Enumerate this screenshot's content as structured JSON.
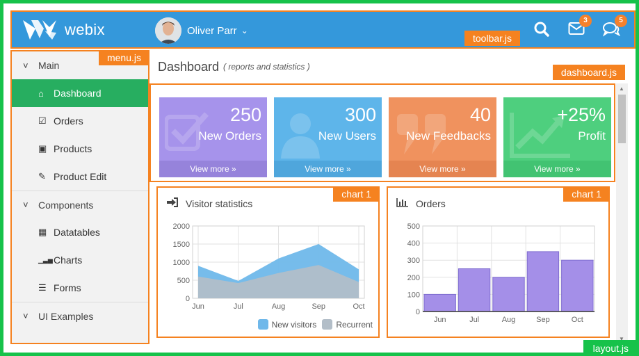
{
  "toolbar": {
    "logo_text": "webix",
    "user_name": "Oliver Parr",
    "mail_badge": "3",
    "chat_badge": "5",
    "tag": "toolbar.js"
  },
  "sidebar": {
    "tag": "menu.js",
    "items": [
      {
        "label": "Main",
        "kind": "group",
        "icon": "chevron-down-icon"
      },
      {
        "label": "Dashboard",
        "kind": "child",
        "icon": "home-icon",
        "active": true
      },
      {
        "label": "Orders",
        "kind": "child",
        "icon": "check-square-icon"
      },
      {
        "label": "Products",
        "kind": "child",
        "icon": "cube-icon"
      },
      {
        "label": "Product Edit",
        "kind": "child",
        "icon": "edit-icon"
      },
      {
        "label": "Components",
        "kind": "group",
        "icon": "chevron-down-icon"
      },
      {
        "label": "Datatables",
        "kind": "child",
        "icon": "table-icon"
      },
      {
        "label": "Charts",
        "kind": "child",
        "icon": "bar-chart-icon"
      },
      {
        "label": "Forms",
        "kind": "child",
        "icon": "form-icon"
      },
      {
        "label": "UI Examples",
        "kind": "group",
        "icon": "chevron-down-icon"
      }
    ]
  },
  "header": {
    "title": "Dashboard",
    "subtitle": "( reports and statistics )",
    "tag": "dashboard.js"
  },
  "tiles": [
    {
      "value": "250",
      "label": "New Orders",
      "more": "View more  »",
      "color": "#a693eb",
      "footer": "#9683db"
    },
    {
      "value": "300",
      "label": "New Users",
      "more": "View more  »",
      "color": "#5eb5ea",
      "footer": "#4fa6dc"
    },
    {
      "value": "40",
      "label": "New Feedbacks",
      "more": "View more  »",
      "color": "#f0925e",
      "footer": "#e58451"
    },
    {
      "value": "+25%",
      "label": "Profit",
      "more": "View more  »",
      "color": "#4ecf7e",
      "footer": "#42c372"
    }
  ],
  "panels": {
    "visitors": {
      "title": "Visitor statistics",
      "tag": "chart 1"
    },
    "orders": {
      "title": "Orders",
      "tag": "chart 1"
    }
  },
  "layout_tag": "layout.js",
  "chart_data": [
    {
      "type": "area",
      "title": "Visitor statistics",
      "categories": [
        "Jun",
        "Jul",
        "Aug",
        "Sep",
        "Oct"
      ],
      "ylim": [
        0,
        2000
      ],
      "yticks": [
        "0",
        "500",
        "1000",
        "1500",
        "2000"
      ],
      "series": [
        {
          "name": "New visitors",
          "values": [
            900,
            480,
            1100,
            1500,
            800
          ],
          "color": "#6fb8ea"
        },
        {
          "name": "Recurrent",
          "values": [
            600,
            420,
            700,
            920,
            450
          ],
          "color": "#b3bec8"
        }
      ],
      "legend": "bottom-right",
      "grid": true
    },
    {
      "type": "bar",
      "title": "Orders",
      "categories": [
        "Jun",
        "Jul",
        "Aug",
        "Sep",
        "Oct"
      ],
      "values": [
        100,
        250,
        200,
        350,
        300
      ],
      "ylim": [
        0,
        500
      ],
      "yticks": [
        "0",
        "100",
        "200",
        "300",
        "400",
        "500"
      ],
      "color": "#a48fe8",
      "grid": true
    }
  ]
}
